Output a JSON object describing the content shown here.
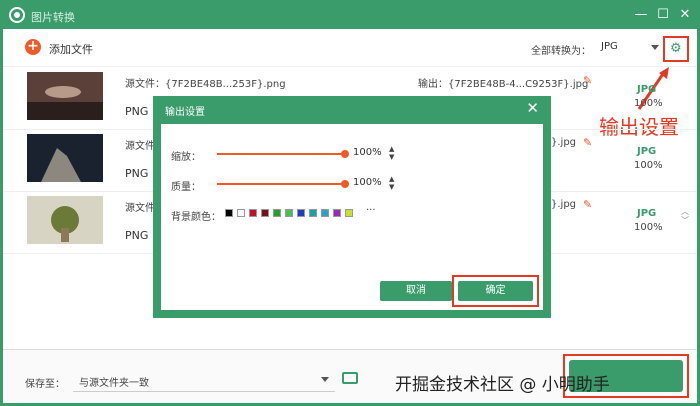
{
  "window": {
    "title": "图片转换"
  },
  "toolbar": {
    "add_label": "添加文件",
    "convert_all_label": "全部转换为：",
    "format_value": "JPG"
  },
  "files": [
    {
      "src": "源文件：{7F2BE48B...253F}.png",
      "fmt": "PNG",
      "out": "输出：{7F2BE48B-4...C9253F}.jpg",
      "target": "JPG",
      "pct": "100%"
    },
    {
      "src": "源文件",
      "fmt": "PNG",
      "out": "}.jpg",
      "target": "JPG",
      "pct": "100%"
    },
    {
      "src": "源文件",
      "fmt": "PNG",
      "out": "}.jpg",
      "target": "JPG",
      "pct": "100%"
    }
  ],
  "annotation": "输出设置",
  "dialog": {
    "title": "输出设置",
    "scale_label": "缩放：",
    "scale_value": "100%",
    "quality_label": "质量：",
    "quality_value": "100%",
    "bg_label": "背景颜色：",
    "more": "···",
    "cancel_label": "取消",
    "ok_label": "确定"
  },
  "swatches": [
    "#000000",
    "#ffffff",
    "#c0102a",
    "#7a0f18",
    "#22a02a",
    "#47c05a",
    "#1b3fbf",
    "#1aa0a8",
    "#2aa3c8",
    "#9a28b8",
    "#c9e02a"
  ],
  "footer": {
    "save_label": "保存至：",
    "path_value": "与源文件夹一致",
    "watermark": "开掘金技术社区 @ 小明助手"
  }
}
